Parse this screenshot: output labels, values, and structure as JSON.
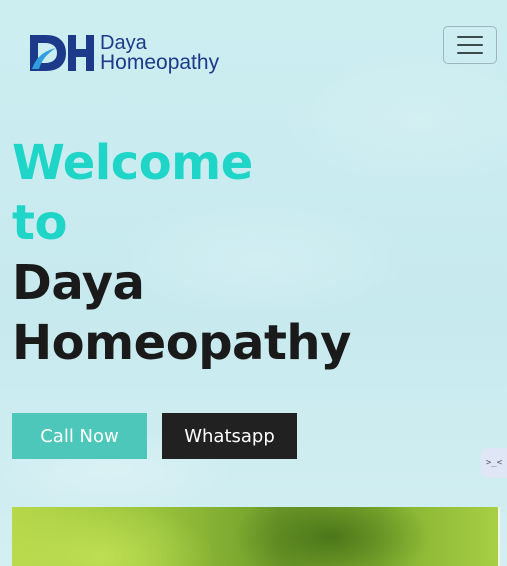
{
  "brand": {
    "initials": "DH",
    "line1": "Daya",
    "line2": "Homeopathy",
    "color": "#1d3a8a"
  },
  "nav": {
    "toggler_icon": "hamburger-menu-icon"
  },
  "hero": {
    "title_line1": "Welcome",
    "title_line2": "to",
    "title_line3": "Daya",
    "title_line4": "Homeopathy",
    "accent_color": "#1fd5c8",
    "text_color": "#1a1a1a"
  },
  "buttons": {
    "call_label": "Call Now",
    "whatsapp_label": "Whatsapp",
    "call_color": "#4cc7ba",
    "whatsapp_color": "#212121"
  },
  "widget": {
    "glyph": ">_<"
  }
}
